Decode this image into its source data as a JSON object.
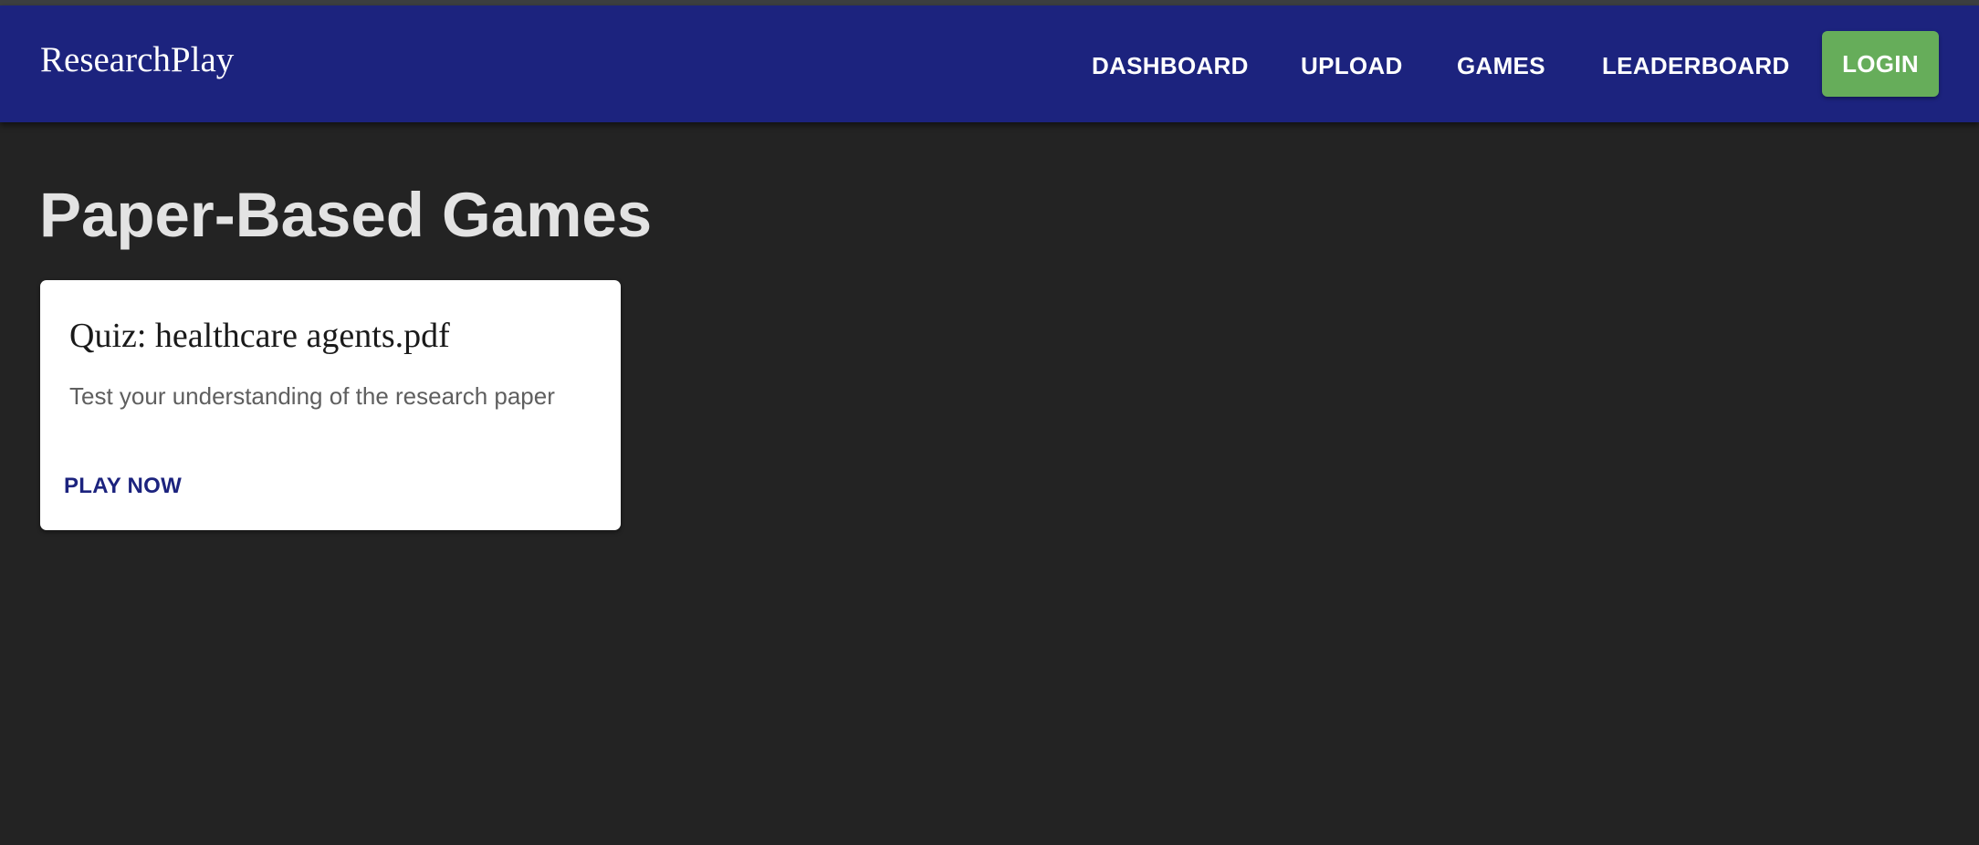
{
  "app": {
    "brand": "ResearchPlay"
  },
  "nav": {
    "items": [
      {
        "label": "DASHBOARD"
      },
      {
        "label": "UPLOAD"
      },
      {
        "label": "GAMES"
      },
      {
        "label": "LEADERBOARD"
      }
    ],
    "login_label": "LOGIN"
  },
  "main": {
    "title": "Paper-Based Games",
    "games": [
      {
        "title": "Quiz: healthcare agents.pdf",
        "description": "Test your understanding of the research paper",
        "action_label": "PLAY NOW"
      }
    ]
  },
  "colors": {
    "appbar": "#1c237e",
    "background": "#232323",
    "login": "#66ad5a",
    "card": "#ffffff",
    "action_text": "#1c237e"
  }
}
